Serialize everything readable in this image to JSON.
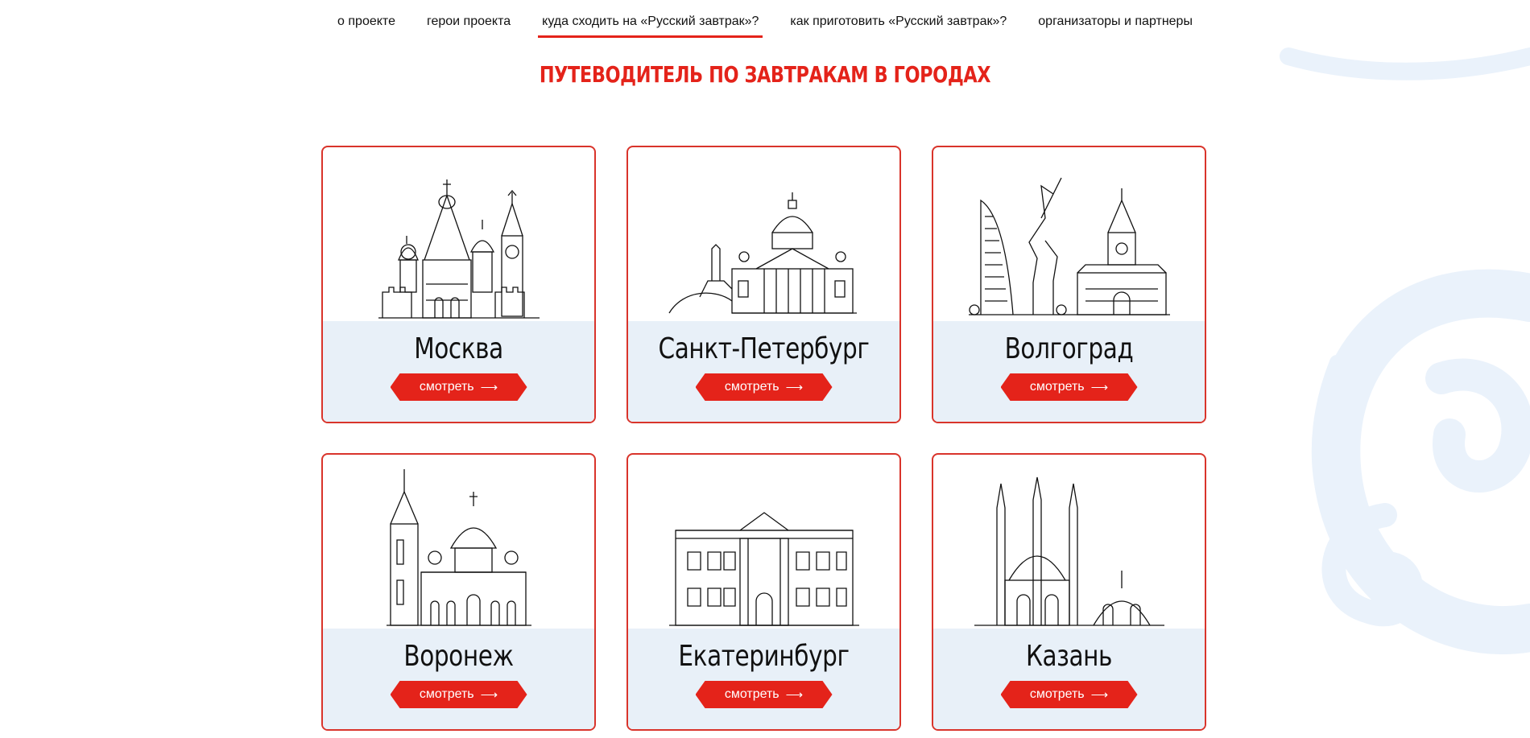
{
  "nav": {
    "items": [
      {
        "label": "о проекте"
      },
      {
        "label": "герои проекта"
      },
      {
        "label": "куда сходить на «Русский завтрак»?"
      },
      {
        "label": "как приготовить «Русский завтрак»?"
      },
      {
        "label": "организаторы и партнеры"
      }
    ],
    "active_index": 2
  },
  "page": {
    "title": "Путеводитель по завтракам в городах"
  },
  "button_arrow": "⟶",
  "cities": [
    {
      "name": "Москва",
      "button": "смотреть",
      "illustration": "moscow-kremlin-icon"
    },
    {
      "name": "Санкт-Петербург",
      "button": "смотреть",
      "illustration": "saint-isaac-cathedral-icon"
    },
    {
      "name": "Волгоград",
      "button": "смотреть",
      "illustration": "motherland-calls-icon"
    },
    {
      "name": "Воронеж",
      "button": "смотреть",
      "illustration": "annunciation-cathedral-icon"
    },
    {
      "name": "Екатеринбург",
      "button": "смотреть",
      "illustration": "classical-mansion-icon"
    },
    {
      "name": "Казань",
      "button": "смотреть",
      "illustration": "kul-sharif-mosque-icon"
    }
  ],
  "colors": {
    "accent": "#e4231a",
    "card_bottom": "#e8f0f8",
    "ornament": "#eaf2fb"
  }
}
